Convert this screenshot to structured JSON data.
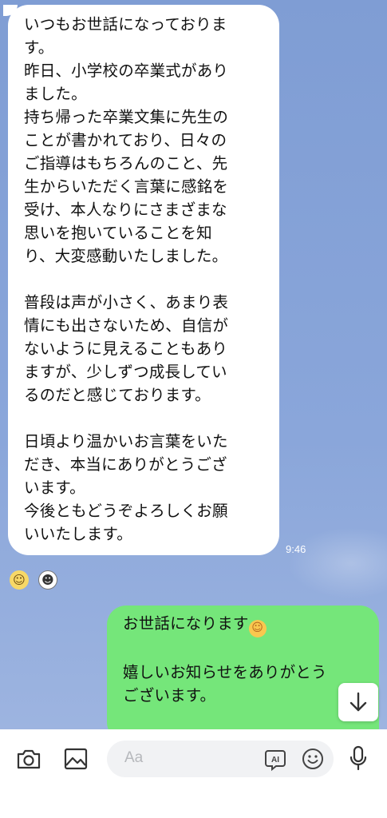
{
  "chat": {
    "incoming": {
      "text": "いつもお世話になっておりま\nす。\n昨日、小学校の卒業式があり\nました。\n持ち帰った卒業文集に先生の\nことが書かれており、日々の\nご指導はもちろんのこと、先\n生からいただく言葉に感銘を\n受け、本人なりにさまざまな\n思いを抱いていることを知\nり、大変感動いたしました。\n\n普段は声が小さく、あまり表\n情にも出さないため、自信が\nないように見えることもあり\nますが、少しずつ成長してい\nるのだと感じております。\n\n日頃より温かいお言葉をいた\nだき、本当にありがとうござ\nいます。\n今後ともどうぞよろしくお願\nいいたします。",
      "time": "9:46"
    },
    "outgoing": {
      "line1": "お世話になります",
      "body": "\n\n嬉しいお知らせをありがとう\nございます。"
    }
  },
  "input": {
    "placeholder": "Aa",
    "ai_label": "AI"
  },
  "icons": [
    "camera-icon",
    "image-icon",
    "ai-icon",
    "emoji-icon",
    "microphone-icon",
    "arrow-down-icon"
  ]
}
